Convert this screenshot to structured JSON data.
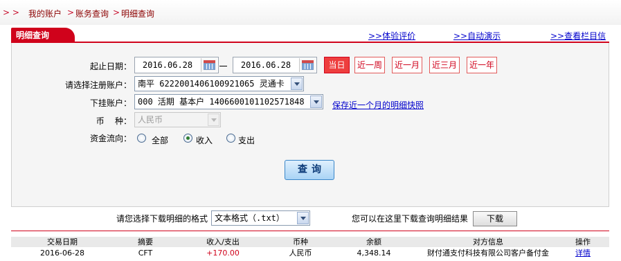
{
  "breadcrumb": {
    "arrows": "> >",
    "items": [
      "我的账户",
      "账务查询",
      "明细查询"
    ],
    "separator": ">"
  },
  "panel": {
    "title": "明细查询",
    "links": [
      ">>体验评价",
      ">>自动演示",
      ">>查看栏目信息"
    ]
  },
  "form": {
    "date_label": "起止日期：",
    "start_date": "2016.06.28",
    "end_date": "2016.06.28",
    "quick_buttons": [
      "当日",
      "近一周",
      "近一月",
      "近三月",
      "近一年"
    ],
    "account_label": "请选择注册账户：",
    "account_value": "南平 6222001406100921065 灵通卡",
    "sub_label": "下挂账户：",
    "sub_value": "000 活期 基本户 1406600101102571848",
    "save_link": "保存近一个月的明细快照",
    "currency_label": "币    种：",
    "currency_value": "人民币",
    "flow_label": "资金流向：",
    "flow_options": [
      "全部",
      "收入",
      "支出"
    ],
    "flow_selected": "收入",
    "query_label": "查询"
  },
  "download": {
    "format_label": "请您选择下载明细的格式",
    "format_value": "文本格式（.txt）",
    "hint": "您可以在这里下载查询明细结果",
    "button": "下载"
  },
  "table": {
    "headers": [
      "交易日期",
      "摘要",
      "收入/支出",
      "币种",
      "余额",
      "对方信息",
      "操作"
    ],
    "rows": [
      [
        "2016-06-28",
        "CFT",
        "+170.00",
        "人民币",
        "4,348.14",
        "财付通支付科技有限公司客户备付金",
        "详情"
      ]
    ]
  },
  "colors": {
    "brand_red": "#d0021b",
    "link_blue": "#0000cc",
    "query_blue": "#3a86c8"
  },
  "icons": [
    "calendar-icon",
    "dropdown-arrow-icon"
  ]
}
